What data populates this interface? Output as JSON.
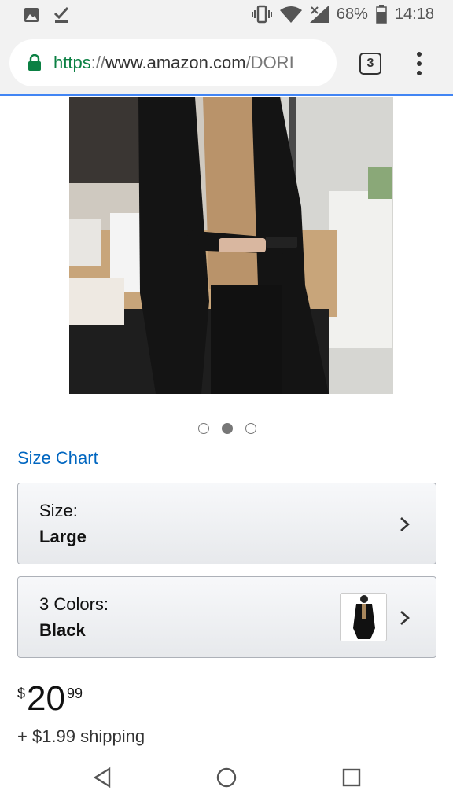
{
  "status_bar": {
    "battery_percent": "68%",
    "time": "14:18",
    "icon_color": "#555555"
  },
  "browser": {
    "url_scheme": "https",
    "url_separator": "://",
    "url_host": "www.amazon.com",
    "url_path": "/DORI",
    "tab_count": "3",
    "accent_color": "#4285f4",
    "secure_color": "#0b8043"
  },
  "product": {
    "carousel_dots": 3,
    "carousel_active": 1,
    "size_chart_label": "Size Chart",
    "size_selector": {
      "label": "Size:",
      "value": "Large"
    },
    "color_selector": {
      "label": "3 Colors:",
      "value": "Black"
    },
    "price": {
      "currency": "$",
      "whole": "20",
      "fraction": "99"
    },
    "shipping": "+ $1.99 shipping",
    "link_color": "#0066c0"
  },
  "nav": {
    "back_icon": "back-triangle-icon",
    "home_icon": "home-circle-icon",
    "recents_icon": "recents-square-icon"
  }
}
